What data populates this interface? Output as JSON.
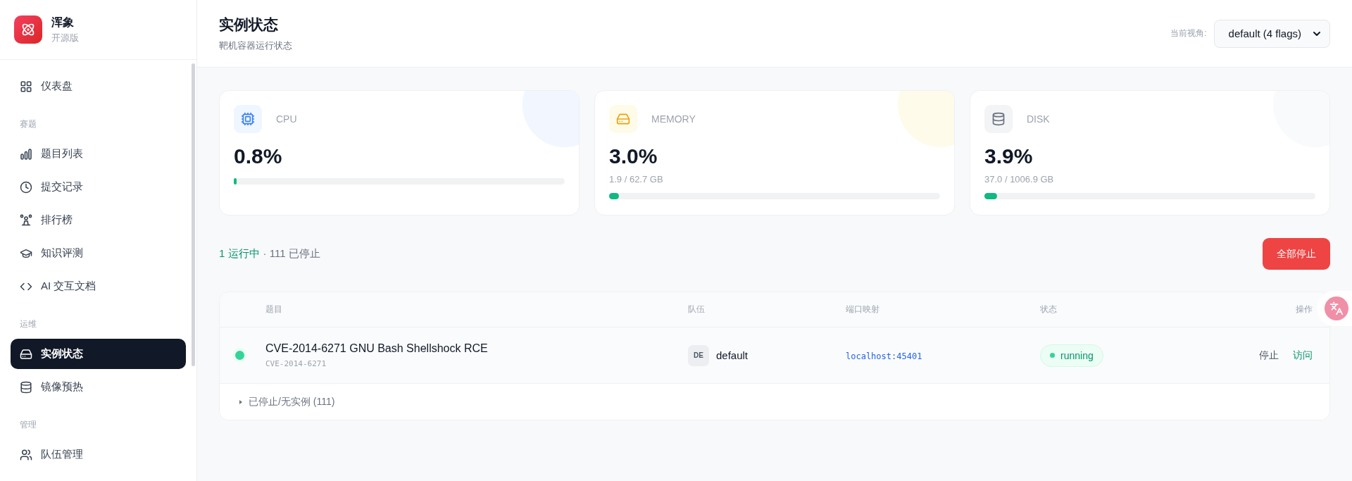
{
  "sidebar": {
    "brand": {
      "name": "浑象",
      "edition": "开源版"
    },
    "sections": [
      {
        "items": [
          {
            "label": "仪表盘",
            "selected": false
          }
        ]
      },
      {
        "title": "赛题",
        "items": [
          {
            "label": "题目列表",
            "selected": false
          },
          {
            "label": "提交记录",
            "selected": false
          },
          {
            "label": "排行榜",
            "selected": false
          },
          {
            "label": "知识评测",
            "selected": false
          },
          {
            "label": "AI 交互文档",
            "selected": false
          }
        ]
      },
      {
        "title": "运维",
        "items": [
          {
            "label": "实例状态",
            "selected": true
          },
          {
            "label": "镜像预热",
            "selected": false
          }
        ]
      },
      {
        "title": "管理",
        "items": [
          {
            "label": "队伍管理",
            "selected": false
          }
        ]
      }
    ]
  },
  "header": {
    "title": "实例状态",
    "subtitle": "靶机容器运行状态",
    "view_label": "当前视角:",
    "view_value": "default (4 flags)"
  },
  "stats": [
    {
      "label": "CPU",
      "value": "0.8%",
      "level": 0.008
    },
    {
      "label": "MEMORY",
      "value": "3.0%",
      "detail": "1.9 / 62.7 GB",
      "level": 0.03
    },
    {
      "label": "DISK",
      "value": "3.9%",
      "detail": "37.0 / 1006.9 GB",
      "level": 0.039
    }
  ],
  "summary": {
    "running": "1 运行中",
    "stopped": "· 111 已停止"
  },
  "stop_all_button": "全部停止",
  "table": {
    "columns": [
      "题目",
      "队伍",
      "端口映射",
      "状态",
      "操作"
    ],
    "rows": [
      {
        "running": true,
        "title": "CVE-2014-6271 GNU Bash Shellshock RCE",
        "id": "CVE-2014-6271",
        "team_badge": "DE",
        "team": "default",
        "port": "localhost:45401",
        "status": "running",
        "actions": [
          "停止",
          "访问"
        ]
      }
    ],
    "footer": {
      "label": "已停止/无实例 (111)",
      "expanded": false
    }
  }
}
